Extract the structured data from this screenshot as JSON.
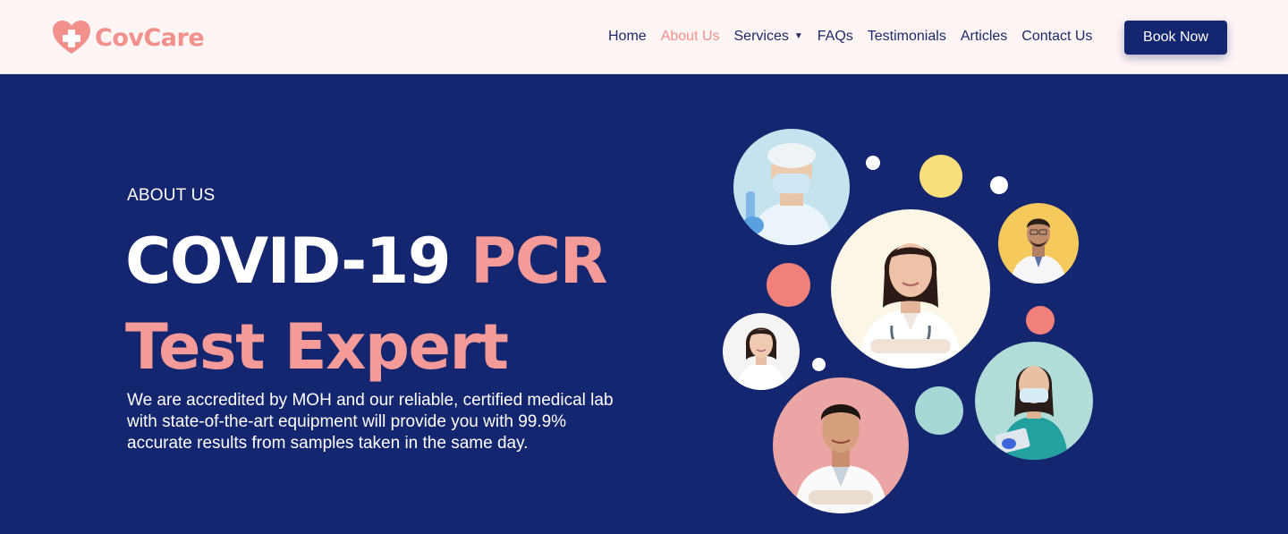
{
  "brand": {
    "name": "CovCare",
    "logo_icon": "heart-cross-icon",
    "color": "#f2908c"
  },
  "nav": {
    "items": [
      {
        "label": "Home",
        "active": false
      },
      {
        "label": "About Us",
        "active": true
      },
      {
        "label": "Services",
        "active": false,
        "dropdown": true
      },
      {
        "label": "FAQs",
        "active": false
      },
      {
        "label": "Testimonials",
        "active": false
      },
      {
        "label": "Articles",
        "active": false
      },
      {
        "label": "Contact Us",
        "active": false
      }
    ],
    "cta_label": "Book Now"
  },
  "hero": {
    "eyebrow": "ABOUT US",
    "headline_white": "COVID-19 ",
    "headline_pink_1": "PCR",
    "headline_pink_2": "Test Expert",
    "description": "We are accredited by MOH and our reliable, certified medical lab with state-of-the-art equipment will provide you with 99.9% accurate results from samples taken in the same day."
  },
  "colors": {
    "background": "#14266f",
    "accent_pink": "#f49a98",
    "header_bg": "#fff5f5"
  }
}
